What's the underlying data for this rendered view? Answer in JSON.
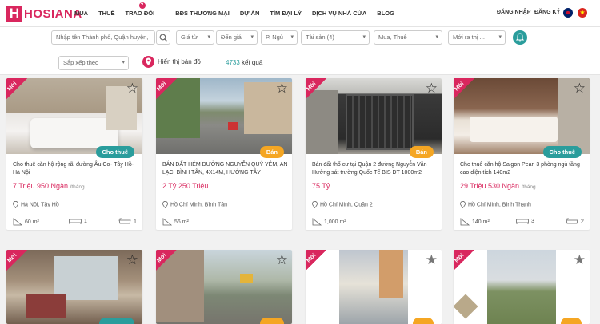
{
  "brand": {
    "logo_letter": "H",
    "name": "HOSIANA"
  },
  "nav": [
    "MUA",
    "THUÊ",
    "TRAO ĐỔI",
    "BĐS THƯƠNG MẠI",
    "DỰ ÁN",
    "TÌM ĐẠI LÝ",
    "DỊCH VỤ NHÀ CỬA",
    "BLOG"
  ],
  "nav_badge": "?",
  "auth": {
    "login": "ĐĂNG NHẬP",
    "register": "ĐĂNG KÝ"
  },
  "filters": {
    "search_placeholder": "Nhập tên Thành phố, Quận huyện,",
    "price_from": "Giá từ",
    "price_to": "Đến giá",
    "bedrooms": "P. Ngủ",
    "property": "Tài sản (4)",
    "mode": "Mua, Thuê",
    "listed": "Mới ra thị ...",
    "sort": "Sắp xếp theo"
  },
  "map_label": "Hiển thị bản đồ",
  "results": {
    "count": "4733",
    "suffix": "kết quả"
  },
  "colors": {
    "brand": "#d9275e",
    "teal": "#2a9d9c",
    "orange": "#f5a623"
  },
  "listings": [
    {
      "badge": "Mới",
      "tag": "Cho thuê",
      "tag_type": "rent",
      "title": "Cho thuê căn hộ rộng rãi đường Âu Cơ- Tây Hồ- Hà Nội",
      "price": "7 Triệu 950 Ngàn",
      "price_unit": "/tháng",
      "location": "Hà Nội, Tây Hồ",
      "area": "60 m²",
      "beds": "1",
      "baths": "1"
    },
    {
      "badge": "Mới",
      "tag": "Bán",
      "tag_type": "sale",
      "title": "BÁN ĐẤT HẺM ĐƯỜNG NGUYỄN QUÝ YÊM, AN LẠC, BÌNH TÂN, 4X14M, HƯỚNG TÂY",
      "price": "2 Tỷ 250 Triệu",
      "price_unit": "",
      "location": "Hồ Chí Minh, Bình Tân",
      "area": "56 m²",
      "beds": "",
      "baths": ""
    },
    {
      "badge": "Mới",
      "tag": "Bán",
      "tag_type": "sale",
      "title": "Bán đất thổ cư tại Quận 2 đường Nguyễn Văn Hưởng sát trường Quốc Tế BIS DT 1000m2",
      "price": "75 Tỷ",
      "price_unit": "",
      "location": "Hồ Chí Minh, Quận 2",
      "area": "1,000 m²",
      "beds": "",
      "baths": ""
    },
    {
      "badge": "Mới",
      "tag": "Cho thuê",
      "tag_type": "rent",
      "title": "Cho thuê căn hộ Saigon Pearl 3 phòng ngủ tầng cao diện tích 140m2",
      "price": "29 Triệu 530 Ngàn",
      "price_unit": "/tháng",
      "location": "Hồ Chí Minh, Bình Thạnh",
      "area": "140 m²",
      "beds": "3",
      "baths": "2"
    },
    {
      "badge": "Mới",
      "tag": "",
      "tag_type": "rent"
    },
    {
      "badge": "Mới",
      "tag": "",
      "tag_type": "sale"
    },
    {
      "badge": "Mới",
      "tag": "",
      "tag_type": "sale"
    },
    {
      "badge": "Mới",
      "tag": "",
      "tag_type": "sale"
    }
  ]
}
